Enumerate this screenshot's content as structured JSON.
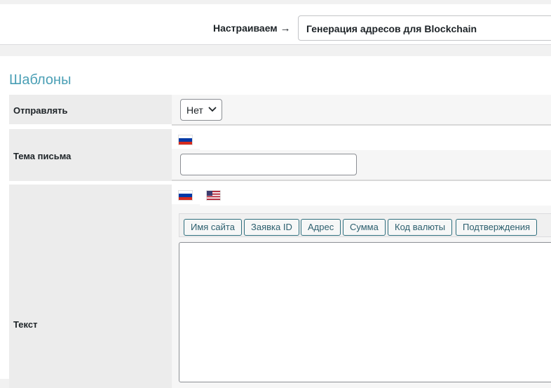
{
  "header": {
    "configuring_label": "Настраиваем",
    "arrow": "→",
    "selected_module": "Генерация адресов для Blockchain"
  },
  "section": {
    "title": "Шаблоны"
  },
  "fields": {
    "send": {
      "label": "Отправлять",
      "value": "Нет"
    },
    "subject": {
      "label": "Тема письма",
      "value": ""
    },
    "text": {
      "label": "Текст",
      "value": ""
    }
  },
  "languages": [
    {
      "code": "ru",
      "icon": "russia-flag-icon"
    },
    {
      "code": "en",
      "icon": "usa-flag-icon"
    }
  ],
  "tag_buttons": [
    "Имя сайта",
    "Заявка ID",
    "Адрес",
    "Сумма",
    "Код валюты",
    "Подтверждения"
  ],
  "colors": {
    "accent": "#4a9fb5",
    "tag_border": "#2f6f7e",
    "label_bg": "#ececec"
  }
}
